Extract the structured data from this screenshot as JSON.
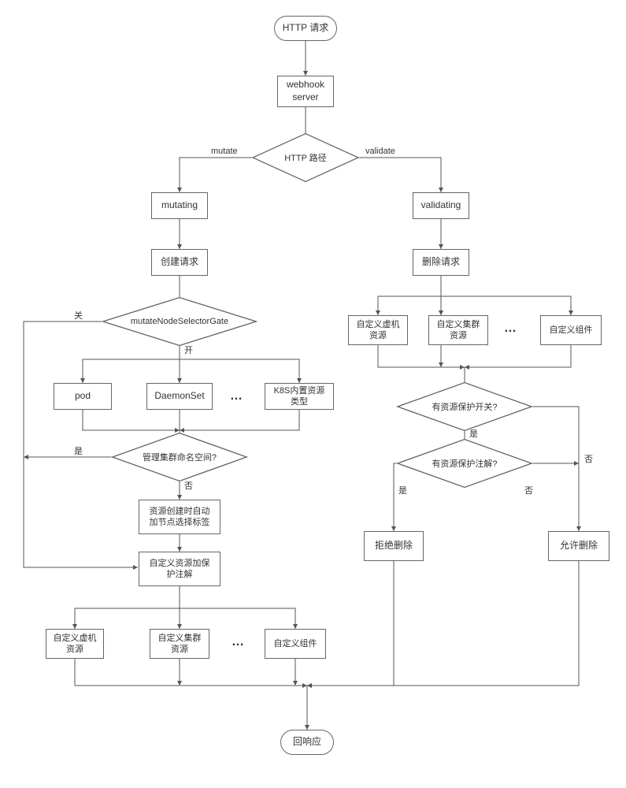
{
  "nodes": {
    "start": "HTTP 请求",
    "webhook": "webhook\nserver",
    "http_path": "HTTP 路径",
    "mutate_label": "mutate",
    "validate_label": "validate",
    "mutating": "mutating",
    "validating": "validating",
    "create_req": "创建请求",
    "delete_req": "删除请求",
    "gate": "mutateNodeSelectorGate",
    "gate_off": "关",
    "gate_on": "开",
    "pod": "pod",
    "daemonset": "DaemonSet",
    "k8s_builtin": "K8S内置资源类型",
    "mgmt_ns": "管理集群命名空间?",
    "yes1": "是",
    "no1": "否",
    "auto_label": "资源创建时自动加节点选择标签",
    "add_protect": "自定义资源加保护注解",
    "cust_vm": "自定义虚机资源",
    "cust_cluster": "自定义集群资源",
    "cust_comp": "自定义组件",
    "v_cust_vm": "自定义虚机资源",
    "v_cust_cluster": "自定义集群资源",
    "v_cust_comp": "自定义组件",
    "has_switch": "有资源保护开关?",
    "yes2": "是",
    "no2": "否",
    "has_anno": "有资源保护注解?",
    "yes3": "是",
    "no3": "否",
    "reject": "拒绝删除",
    "allow": "允许删除",
    "response": "回响应",
    "dots": "…"
  }
}
